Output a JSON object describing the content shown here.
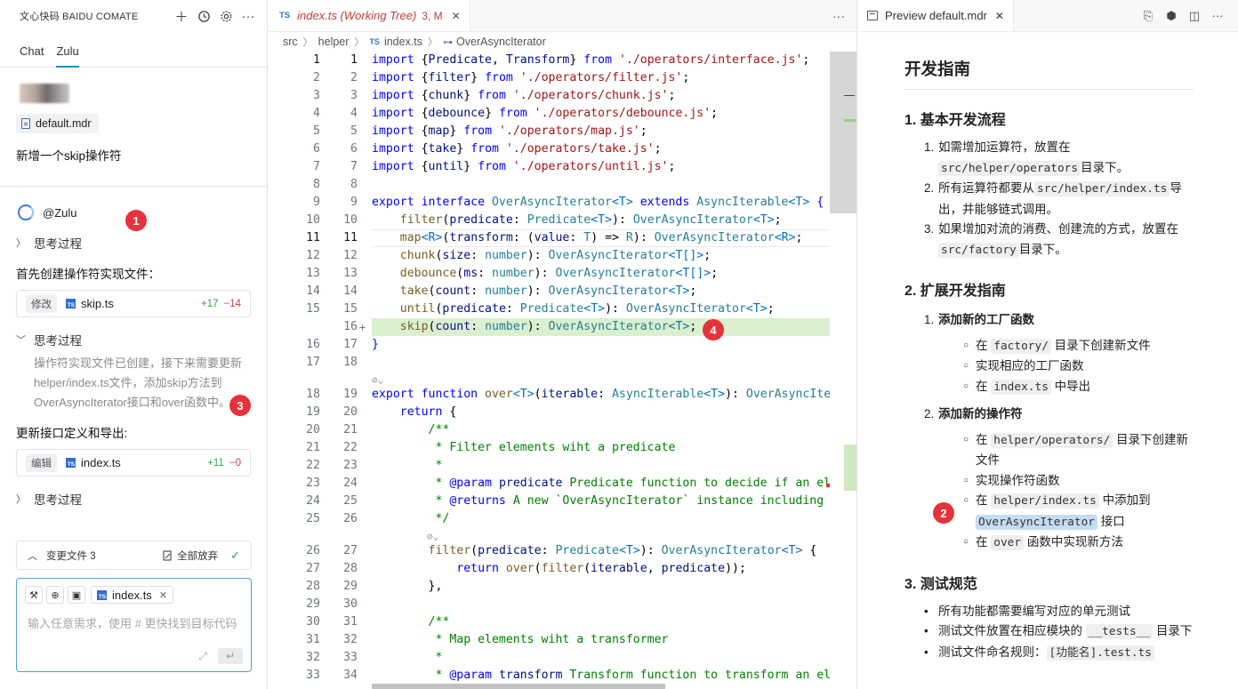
{
  "left": {
    "header_title": "文心快码 BAIDU COMATE",
    "tabs": [
      "Chat",
      "Zulu"
    ],
    "active_tab": "Zulu",
    "attached_file": "default.mdr",
    "user_message": "新增一个skip操作符",
    "agent_name": "@Zulu",
    "thinking_label": "思考过程",
    "step1_text": "首先创建操作符实现文件：",
    "edit1": {
      "tag": "修改",
      "file": "skip.ts",
      "added": "+17",
      "removed": "−14"
    },
    "thinking_expanded_text": "操作符实现文件已创建，接下来需要更新helper/index.ts文件，添加skip方法到OverAsyncIterator接口和over函数中。",
    "step2_text": "更新接口定义和导出:",
    "edit2": {
      "tag": "编辑",
      "file": "index.ts",
      "added": "+11",
      "removed": "−0"
    },
    "changes_label": "变更文件 3",
    "discard_all_label": "全部放弃",
    "input_file_chip": "index.ts",
    "input_placeholder": "输入任意需求，使用 # 更快找到目标代码"
  },
  "badges": {
    "b1": "1",
    "b2": "2",
    "b3": "3",
    "b4": "4"
  },
  "editor": {
    "tab_label": "index.ts (Working Tree)",
    "tab_status": "3, M",
    "tab_lang": "TS",
    "breadcrumb": [
      "src",
      "helper",
      "index.ts",
      "OverAsyncIterator"
    ]
  },
  "code_lines": [
    {
      "a": "1",
      "b": "1",
      "cur": true,
      "code": [
        [
          "k",
          "import "
        ],
        [
          "b",
          "{"
        ],
        [
          "p",
          "Predicate"
        ],
        [
          "b",
          ", "
        ],
        [
          "p",
          "Transform"
        ],
        [
          "b",
          "} "
        ],
        [
          "k",
          "from "
        ],
        [
          "s",
          "'./operators/interface.js'"
        ],
        [
          "b",
          ";"
        ]
      ]
    },
    {
      "a": "2",
      "b": "2",
      "code": [
        [
          "k",
          "import "
        ],
        [
          "b",
          "{"
        ],
        [
          "p",
          "filter"
        ],
        [
          "b",
          "} "
        ],
        [
          "k",
          "from "
        ],
        [
          "s",
          "'./operators/filter.js'"
        ],
        [
          "b",
          ";"
        ]
      ]
    },
    {
      "a": "3",
      "b": "3",
      "code": [
        [
          "k",
          "import "
        ],
        [
          "b",
          "{"
        ],
        [
          "p",
          "chunk"
        ],
        [
          "b",
          "} "
        ],
        [
          "k",
          "from "
        ],
        [
          "s",
          "'./operators/chunk.js'"
        ],
        [
          "b",
          ";"
        ]
      ]
    },
    {
      "a": "4",
      "b": "4",
      "code": [
        [
          "k",
          "import "
        ],
        [
          "b",
          "{"
        ],
        [
          "p",
          "debounce"
        ],
        [
          "b",
          "} "
        ],
        [
          "k",
          "from "
        ],
        [
          "s",
          "'./operators/debounce.js'"
        ],
        [
          "b",
          ";"
        ]
      ]
    },
    {
      "a": "5",
      "b": "5",
      "code": [
        [
          "k",
          "import "
        ],
        [
          "b",
          "{"
        ],
        [
          "p",
          "map"
        ],
        [
          "b",
          "} "
        ],
        [
          "k",
          "from "
        ],
        [
          "s",
          "'./operators/map.js'"
        ],
        [
          "b",
          ";"
        ]
      ]
    },
    {
      "a": "6",
      "b": "6",
      "code": [
        [
          "k",
          "import "
        ],
        [
          "b",
          "{"
        ],
        [
          "p",
          "take"
        ],
        [
          "b",
          "} "
        ],
        [
          "k",
          "from "
        ],
        [
          "s",
          "'./operators/take.js'"
        ],
        [
          "b",
          ";"
        ]
      ]
    },
    {
      "a": "7",
      "b": "7",
      "code": [
        [
          "k",
          "import "
        ],
        [
          "b",
          "{"
        ],
        [
          "p",
          "until"
        ],
        [
          "b",
          "} "
        ],
        [
          "k",
          "from "
        ],
        [
          "s",
          "'./operators/until.js'"
        ],
        [
          "b",
          ";"
        ]
      ]
    },
    {
      "a": "8",
      "b": "8",
      "code": []
    },
    {
      "a": "9",
      "b": "9",
      "code": [
        [
          "k",
          "export "
        ],
        [
          "k",
          "interface "
        ],
        [
          "t",
          "OverAsyncIterator"
        ],
        [
          "d",
          "<T> "
        ],
        [
          "k",
          "extends "
        ],
        [
          "t",
          "AsyncIterable"
        ],
        [
          "d",
          "<T> "
        ],
        [
          "k",
          "{"
        ]
      ]
    },
    {
      "a": "10",
      "b": "10",
      "code": [
        [
          "b",
          "    "
        ],
        [
          "f",
          "filter"
        ],
        [
          "b",
          "("
        ],
        [
          "p",
          "predicate"
        ],
        [
          "b",
          ": "
        ],
        [
          "t",
          "Predicate"
        ],
        [
          "d",
          "<T>"
        ],
        [
          "b",
          "): "
        ],
        [
          "t",
          "OverAsyncIterator"
        ],
        [
          "d",
          "<T>"
        ],
        [
          "b",
          ";"
        ]
      ]
    },
    {
      "a": "11",
      "b": "11",
      "cur": true,
      "code": [
        [
          "b",
          "    "
        ],
        [
          "f",
          "map"
        ],
        [
          "d",
          "<R>"
        ],
        [
          "b",
          "("
        ],
        [
          "p",
          "transform"
        ],
        [
          "b",
          ": ("
        ],
        [
          "p",
          "value"
        ],
        [
          "b",
          ": "
        ],
        [
          "t",
          "T"
        ],
        [
          "b",
          ") => "
        ],
        [
          "t",
          "R"
        ],
        [
          "b",
          "): "
        ],
        [
          "t",
          "OverAsyncIterator"
        ],
        [
          "d",
          "<R>"
        ],
        [
          "b",
          ";"
        ]
      ]
    },
    {
      "a": "12",
      "b": "12",
      "code": [
        [
          "b",
          "    "
        ],
        [
          "f",
          "chunk"
        ],
        [
          "b",
          "("
        ],
        [
          "p",
          "size"
        ],
        [
          "b",
          ": "
        ],
        [
          "t",
          "number"
        ],
        [
          "b",
          "): "
        ],
        [
          "t",
          "OverAsyncIterator"
        ],
        [
          "d",
          "<T[]>"
        ],
        [
          "b",
          ";"
        ]
      ]
    },
    {
      "a": "13",
      "b": "13",
      "code": [
        [
          "b",
          "    "
        ],
        [
          "f",
          "debounce"
        ],
        [
          "b",
          "("
        ],
        [
          "p",
          "ms"
        ],
        [
          "b",
          ": "
        ],
        [
          "t",
          "number"
        ],
        [
          "b",
          "): "
        ],
        [
          "t",
          "OverAsyncIterator"
        ],
        [
          "d",
          "<T[]>"
        ],
        [
          "b",
          ";"
        ]
      ]
    },
    {
      "a": "14",
      "b": "14",
      "code": [
        [
          "b",
          "    "
        ],
        [
          "f",
          "take"
        ],
        [
          "b",
          "("
        ],
        [
          "p",
          "count"
        ],
        [
          "b",
          ": "
        ],
        [
          "t",
          "number"
        ],
        [
          "b",
          "): "
        ],
        [
          "t",
          "OverAsyncIterator"
        ],
        [
          "d",
          "<T>"
        ],
        [
          "b",
          ";"
        ]
      ]
    },
    {
      "a": "15",
      "b": "15",
      "code": [
        [
          "b",
          "    "
        ],
        [
          "f",
          "until"
        ],
        [
          "b",
          "("
        ],
        [
          "p",
          "predicate"
        ],
        [
          "b",
          ": "
        ],
        [
          "t",
          "Predicate"
        ],
        [
          "d",
          "<T>"
        ],
        [
          "b",
          "): "
        ],
        [
          "t",
          "OverAsyncIterator"
        ],
        [
          "d",
          "<T>"
        ],
        [
          "b",
          ";"
        ]
      ]
    },
    {
      "a": "",
      "b": "16",
      "add": true,
      "code": [
        [
          "b",
          "    "
        ],
        [
          "f",
          "skip"
        ],
        [
          "b",
          "("
        ],
        [
          "p",
          "count"
        ],
        [
          "b",
          ": "
        ],
        [
          "t",
          "number"
        ],
        [
          "b",
          "): "
        ],
        [
          "t",
          "OverAsyncIterator"
        ],
        [
          "d",
          "<T>"
        ],
        [
          "b",
          ";"
        ]
      ]
    },
    {
      "a": "16",
      "b": "17",
      "code": [
        [
          "k",
          "}"
        ]
      ]
    },
    {
      "a": "17",
      "b": "18",
      "code": []
    },
    {
      "lens": true
    },
    {
      "a": "18",
      "b": "19",
      "code": [
        [
          "k",
          "export "
        ],
        [
          "k",
          "function "
        ],
        [
          "f",
          "over"
        ],
        [
          "d",
          "<T>"
        ],
        [
          "b",
          "("
        ],
        [
          "p",
          "iterable"
        ],
        [
          "b",
          ": "
        ],
        [
          "t",
          "AsyncIterable"
        ],
        [
          "d",
          "<T>"
        ],
        [
          "b",
          "): "
        ],
        [
          "t",
          "OverAsyncIter"
        ]
      ]
    },
    {
      "a": "19",
      "b": "20",
      "code": [
        [
          "b",
          "    "
        ],
        [
          "k",
          "return "
        ],
        [
          "b",
          "{"
        ]
      ]
    },
    {
      "a": "20",
      "b": "21",
      "code": [
        [
          "b",
          "        "
        ],
        [
          "c",
          "/**"
        ]
      ]
    },
    {
      "a": "21",
      "b": "22",
      "code": [
        [
          "b",
          "         "
        ],
        [
          "c",
          "* Filter elements wiht a predicate"
        ]
      ]
    },
    {
      "a": "22",
      "b": "23",
      "code": [
        [
          "b",
          "         "
        ],
        [
          "c",
          "*"
        ]
      ]
    },
    {
      "a": "23",
      "b": "24",
      "code": [
        [
          "b",
          "         "
        ],
        [
          "c",
          "* "
        ],
        [
          "k",
          "@param "
        ],
        [
          "p",
          "predicate "
        ],
        [
          "c",
          "Predicate function to decide if an ele"
        ]
      ]
    },
    {
      "a": "24",
      "b": "25",
      "code": [
        [
          "b",
          "         "
        ],
        [
          "c",
          "* "
        ],
        [
          "k",
          "@returns "
        ],
        [
          "c",
          "A new `OverAsyncIterator` instance including t"
        ]
      ]
    },
    {
      "a": "25",
      "b": "26",
      "code": [
        [
          "b",
          "         "
        ],
        [
          "c",
          "*/"
        ]
      ]
    },
    {
      "lens": true
    },
    {
      "a": "26",
      "b": "27",
      "code": [
        [
          "b",
          "        "
        ],
        [
          "f",
          "filter"
        ],
        [
          "b",
          "("
        ],
        [
          "p",
          "predicate"
        ],
        [
          "b",
          ": "
        ],
        [
          "t",
          "Predicate"
        ],
        [
          "d",
          "<T>"
        ],
        [
          "b",
          "): "
        ],
        [
          "t",
          "OverAsyncIterator"
        ],
        [
          "d",
          "<T> "
        ],
        [
          "b",
          "{"
        ]
      ]
    },
    {
      "a": "27",
      "b": "28",
      "code": [
        [
          "b",
          "            "
        ],
        [
          "k",
          "return "
        ],
        [
          "f",
          "over"
        ],
        [
          "b",
          "("
        ],
        [
          "f",
          "filter"
        ],
        [
          "b",
          "("
        ],
        [
          "p",
          "iterable"
        ],
        [
          "b",
          ", "
        ],
        [
          "p",
          "predicate"
        ],
        [
          "b",
          "));"
        ]
      ]
    },
    {
      "a": "28",
      "b": "29",
      "code": [
        [
          "b",
          "        },"
        ]
      ]
    },
    {
      "a": "29",
      "b": "30",
      "code": []
    },
    {
      "a": "30",
      "b": "31",
      "code": [
        [
          "b",
          "        "
        ],
        [
          "c",
          "/**"
        ]
      ]
    },
    {
      "a": "31",
      "b": "32",
      "code": [
        [
          "b",
          "         "
        ],
        [
          "c",
          "* Map elements wiht a transformer"
        ]
      ]
    },
    {
      "a": "32",
      "b": "33",
      "code": [
        [
          "b",
          "         "
        ],
        [
          "c",
          "*"
        ]
      ]
    },
    {
      "a": "33",
      "b": "34",
      "code": [
        [
          "b",
          "         "
        ],
        [
          "c",
          "* "
        ],
        [
          "k",
          "@param "
        ],
        [
          "p",
          "transform "
        ],
        [
          "c",
          "Transform function to transform an ele"
        ]
      ]
    }
  ],
  "preview": {
    "tab_label": "Preview default.mdr",
    "h1": "开发指南",
    "sec1_title": "1. 基本开发流程",
    "sec1_items": [
      {
        "mk": "1.",
        "parts": [
          [
            "t",
            "如需增加运算符，放置在"
          ],
          [
            "c",
            "src/helper/operators"
          ],
          [
            "t",
            "目录下。"
          ]
        ]
      },
      {
        "mk": "2.",
        "parts": [
          [
            "t",
            "所有运算符都要从"
          ],
          [
            "c",
            "src/helper/index.ts"
          ],
          [
            "t",
            "导出，并能够链式调用。"
          ]
        ]
      },
      {
        "mk": "3.",
        "parts": [
          [
            "t",
            "如果增加对流的消费、创建流的方式，放置在"
          ],
          [
            "c",
            "src/factory"
          ],
          [
            "t",
            "目录下。"
          ]
        ]
      }
    ],
    "sec2_title": "2. 扩展开发指南",
    "sec2_sub1": "添加新的工厂函数",
    "sec2_sub1_items": [
      {
        "parts": [
          [
            "t",
            "在 "
          ],
          [
            "c",
            "factory/"
          ],
          [
            "t",
            " 目录下创建新文件"
          ]
        ]
      },
      {
        "parts": [
          [
            "t",
            "实现相应的工厂函数"
          ]
        ]
      },
      {
        "parts": [
          [
            "t",
            "在 "
          ],
          [
            "c",
            "index.ts"
          ],
          [
            "t",
            " 中导出"
          ]
        ]
      }
    ],
    "sec2_sub2": "添加新的操作符",
    "sec2_sub2_items": [
      {
        "parts": [
          [
            "t",
            "在 "
          ],
          [
            "c",
            "helper/operators/"
          ],
          [
            "t",
            " 目录下创建新文件"
          ]
        ]
      },
      {
        "parts": [
          [
            "t",
            "实现操作符函数"
          ]
        ]
      },
      {
        "parts": [
          [
            "t",
            "在 "
          ],
          [
            "c",
            "helper/index.ts"
          ],
          [
            "t",
            " 中添加到 "
          ],
          [
            "h",
            "OverAsyncIterator"
          ],
          [
            "t",
            " 接口"
          ]
        ]
      },
      {
        "parts": [
          [
            "t",
            "在 "
          ],
          [
            "c",
            "over"
          ],
          [
            "t",
            " 函数中实现新方法"
          ]
        ]
      }
    ],
    "sec3_title": "3. 测试规范",
    "sec3_items": [
      {
        "parts": [
          [
            "t",
            "所有功能都需要编写对应的单元测试"
          ]
        ]
      },
      {
        "parts": [
          [
            "t",
            "测试文件放置在相应模块的 "
          ],
          [
            "c",
            "__tests__"
          ],
          [
            "t",
            " 目录下"
          ]
        ]
      },
      {
        "parts": [
          [
            "t",
            "测试文件命名规则："
          ],
          [
            "c",
            "[功能名].test.ts"
          ]
        ]
      }
    ]
  }
}
